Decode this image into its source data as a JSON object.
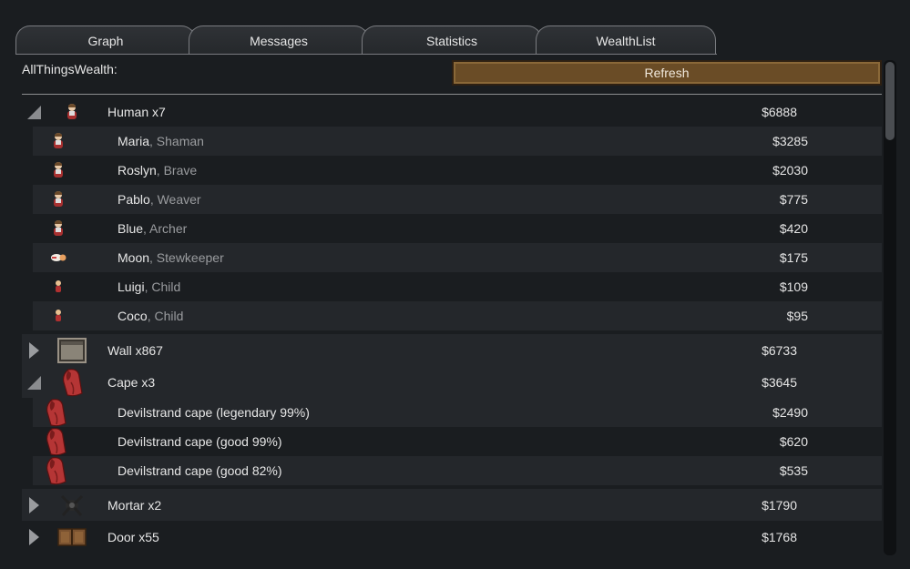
{
  "tabs": [
    {
      "label": "Graph"
    },
    {
      "label": "Messages"
    },
    {
      "label": "Statistics"
    },
    {
      "label": "WealthList"
    }
  ],
  "header": {
    "title": "AllThingsWealth:",
    "refresh_label": "Refresh"
  },
  "colors": {
    "refresh_button": "#6a4c26",
    "row_alt": "#24272b",
    "background": "#1a1d20",
    "cape_red": "#b53535"
  },
  "groups": [
    {
      "label": "Human x7",
      "value": "$6888",
      "expanded": true,
      "icon": "pawn-icon",
      "items": [
        {
          "name": "Maria",
          "role": ", Shaman",
          "value": "$3285",
          "icon": "pawn-icon"
        },
        {
          "name": "Roslyn",
          "role": ", Brave",
          "value": "$2030",
          "icon": "pawn-icon"
        },
        {
          "name": "Pablo",
          "role": ", Weaver",
          "value": "$775",
          "icon": "pawn-icon"
        },
        {
          "name": "Blue",
          "role": ", Archer",
          "value": "$420",
          "icon": "pawn-icon"
        },
        {
          "name": "Moon",
          "role": ", Stewkeeper",
          "value": "$175",
          "icon": "pawn-lying-icon"
        },
        {
          "name": "Luigi",
          "role": ", Child",
          "value": "$109",
          "icon": "child-icon"
        },
        {
          "name": "Coco",
          "role": ", Child",
          "value": "$95",
          "icon": "child-icon"
        }
      ]
    },
    {
      "label": "Wall x867",
      "value": "$6733",
      "expanded": false,
      "icon": "wall-icon",
      "items": []
    },
    {
      "label": "Cape x3",
      "value": "$3645",
      "expanded": true,
      "icon": "cape-icon",
      "items": [
        {
          "name": "Devilstrand cape (legendary 99%)",
          "role": "",
          "value": "$2490",
          "icon": "cape-icon"
        },
        {
          "name": "Devilstrand cape (good 99%)",
          "role": "",
          "value": "$620",
          "icon": "cape-icon"
        },
        {
          "name": "Devilstrand cape (good 82%)",
          "role": "",
          "value": "$535",
          "icon": "cape-icon"
        }
      ]
    },
    {
      "label": "Mortar x2",
      "value": "$1790",
      "expanded": false,
      "icon": "mortar-icon",
      "items": []
    },
    {
      "label": "Door x55",
      "value": "$1768",
      "expanded": false,
      "icon": "door-icon",
      "items": []
    }
  ]
}
